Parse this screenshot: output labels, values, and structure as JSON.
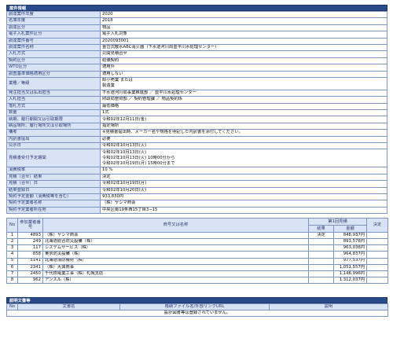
{
  "detail": {
    "title": "案件情報",
    "rows": [
      {
        "label": "調達案件年度",
        "value": "2020"
      },
      {
        "label": "名簿年度",
        "value": "2018"
      },
      {
        "label": "調達区分",
        "value": "物品"
      },
      {
        "label": "電子入札案件区分",
        "value": "電子入札対象"
      },
      {
        "label": "調達案件番号",
        "value": "2020093001"
      },
      {
        "label": "調達案件名称",
        "value": "畳岱式散水ABC消火器（下水道河川局豊平川水処理センター）"
      },
      {
        "label": "入札方式",
        "value": "公開見積合せ"
      },
      {
        "label": "契約区分",
        "value": "総価契約"
      },
      {
        "label": "WTO区分",
        "value": "適用外"
      },
      {
        "label": "調査基準価格適用区分",
        "value": "適用しない"
      },
      {
        "label": "業種／等級",
        "lines": [
          "卸小売業 または",
          "製造業"
        ]
      },
      {
        "label": "発注担当又は払出担当",
        "value": "下水道河川局事業推進部 ／ 豊平川水処理センター"
      },
      {
        "label": "入札担当",
        "value": "財政局管財部 ／ 契約管理課 ／ 物品契約係"
      },
      {
        "label": "落札方式",
        "value": "最低価格"
      },
      {
        "label": "数量",
        "value": "1式"
      },
      {
        "label": "納期、履行期間又は引取期限",
        "value": "令和02年12月11日(金)"
      },
      {
        "label": "納品場所、履行場所又は引取場所",
        "value": "指定場所"
      },
      {
        "label": "備考",
        "value": "※見積書提出時、メーカー名や規格を明記した内訳書を添付してください。"
      },
      {
        "label": "内訳書提出",
        "value": "必要"
      },
      {
        "label": "公示日",
        "value": "令和02年10月13日(火)"
      },
      {
        "label": "見積書受付予定期間",
        "lines": [
          "令和02年10月13日(火)",
          "令和02年10月13日(火) 10時00分から",
          "令和02年10月19日(月) 15時00分まで"
        ]
      },
      {
        "label": "消費税率",
        "value": "10 %"
      },
      {
        "label": "見積（合せ）結果",
        "value": "決定"
      },
      {
        "label": "見積（合せ）日",
        "value": "令和02年10月19日(月)"
      },
      {
        "label": "結果登録日",
        "value": "令和02年10月20日(火)"
      },
      {
        "label": "契約予定金額（消費税等を含む）",
        "value": "933,830円"
      },
      {
        "label": "契約予定業者名称",
        "value": "（株）ヤシマ商会"
      },
      {
        "label": "契約予定業者所在地",
        "value": "中央区南19条西15丁目3−15"
      }
    ]
  },
  "bids": {
    "headers": {
      "no": "No",
      "reg": "参加業者番号",
      "name": "商号又は名称",
      "round": "第1回見積",
      "result": "結果",
      "amount": "金額",
      "decision": "決定"
    },
    "rows": [
      {
        "no": "1",
        "reg": "4893",
        "name": "（株）ヤシマ商会",
        "result": "決定",
        "amount": "848,937円"
      },
      {
        "no": "2",
        "reg": "249",
        "name": "北海道総合防災設備（株）",
        "result": "",
        "amount": "893,576円"
      },
      {
        "no": "3",
        "reg": "117",
        "name": "シズテムサービス（株）",
        "result": "",
        "amount": "963,036円"
      },
      {
        "no": "4",
        "reg": "858",
        "name": "東京防災設備（株）",
        "result": "",
        "amount": "964,837円"
      },
      {
        "no": "5",
        "reg": "5141",
        "name": "北海道消防機材（株）",
        "result": "",
        "amount": "977,537円"
      },
      {
        "no": "6",
        "reg": "2341",
        "name": "（株）大興商事",
        "result": "",
        "amount": "1,051,557円"
      },
      {
        "no": "7",
        "reg": "2450",
        "name": "千代田電業工事（株）札幌支店",
        "result": "",
        "amount": "1,146,996円"
      },
      {
        "no": "8",
        "reg": "962",
        "name": "アンスル（株）",
        "result": "",
        "amount": "1,312,037円"
      }
    ]
  },
  "docs": {
    "title": "説明文書等",
    "headers": {
      "no": "No",
      "doc": "文書名",
      "file": "格納ファイル名/外部リンクURL",
      "note": "説明"
    },
    "empty_message": "設計図書等は登録されていません。"
  }
}
